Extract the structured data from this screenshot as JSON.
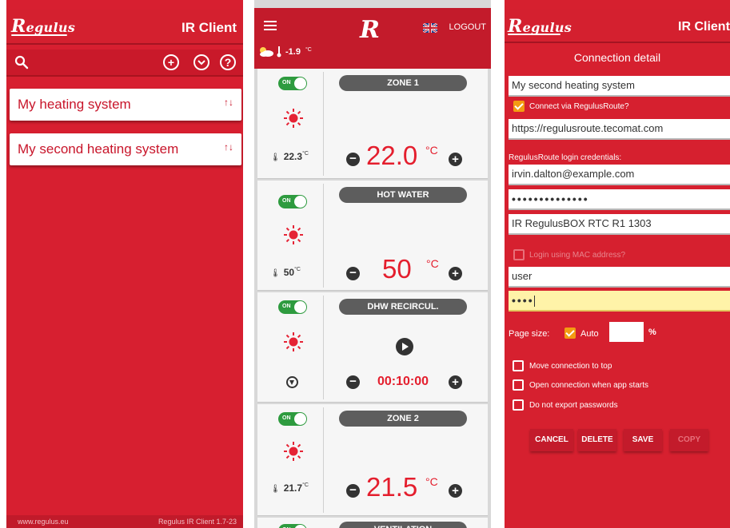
{
  "colors": {
    "brand_red": "#d71f30",
    "accent_orange": "#f39c12",
    "on_green": "#2e9b3f",
    "temp_red": "#e41e2d"
  },
  "screen1": {
    "logo": {
      "initial": "R",
      "rest": "egulus"
    },
    "title": "IR Client",
    "toolbar_icons": [
      "search-icon",
      "add-icon",
      "dropdown-icon",
      "help-icon"
    ],
    "connections": [
      {
        "label": "My heating system",
        "icon": "sort-icon"
      },
      {
        "label": "My second heating system",
        "icon": "sort-icon"
      }
    ],
    "footer": {
      "site": "www.regulus.eu",
      "version": "Regulus IR Client 1.7-23"
    }
  },
  "screen2": {
    "header": {
      "logo": "R",
      "logout": "LOGOUT",
      "flag": "uk-flag-icon"
    },
    "weather": {
      "icon": "partly-cloudy-icon",
      "outdoor_temp": "-1.9",
      "unit": "°C"
    },
    "zones": [
      {
        "title": "ZONE 1",
        "toggle": "ON",
        "measured": "22.3",
        "measured_unit": "°C",
        "setpoint": "22.0",
        "setpoint_unit": "°C"
      },
      {
        "title": "HOT WATER",
        "toggle": "ON",
        "measured": "50",
        "measured_unit": "°C",
        "setpoint": "50",
        "setpoint_unit": "°C"
      },
      {
        "title": "DHW RECIRCUL.",
        "toggle": "ON",
        "timer": "00:10:00"
      },
      {
        "title": "ZONE 2",
        "toggle": "ON",
        "measured": "21.7",
        "measured_unit": "°C",
        "setpoint": "21.5",
        "setpoint_unit": "°C"
      },
      {
        "title": "VENTILATION",
        "toggle": "ON"
      }
    ]
  },
  "screen3": {
    "logo": {
      "initial": "R",
      "rest": "egulus"
    },
    "title": "IR Client",
    "subtitle": "Connection detail",
    "connection_name": "My second heating system",
    "connect_via_route": {
      "label": "Connect via RegulusRoute?",
      "checked": true
    },
    "route_url": "https://regulusroute.tecomat.com",
    "route_credentials_label": "RegulusRoute login credentials:",
    "route_email": "irvin.dalton@example.com",
    "route_password_mask": "••••••••••••••",
    "device_name": "IR RegulusBOX RTC R1 1303",
    "login_mac": {
      "label": "Login using MAC address?",
      "checked": false,
      "enabled": false
    },
    "username": "user",
    "password_mask": "••••",
    "page_size": {
      "label": "Page size:",
      "auto_label": "Auto",
      "auto_checked": true,
      "value": "",
      "percent": "%"
    },
    "options": [
      {
        "label": "Move connection to top",
        "checked": false
      },
      {
        "label": "Open connection when app starts",
        "checked": false
      },
      {
        "label": "Do not export passwords",
        "checked": false
      }
    ],
    "buttons": {
      "cancel": "CANCEL",
      "delete": "DELETE",
      "save": "SAVE",
      "copy": "COPY"
    }
  }
}
